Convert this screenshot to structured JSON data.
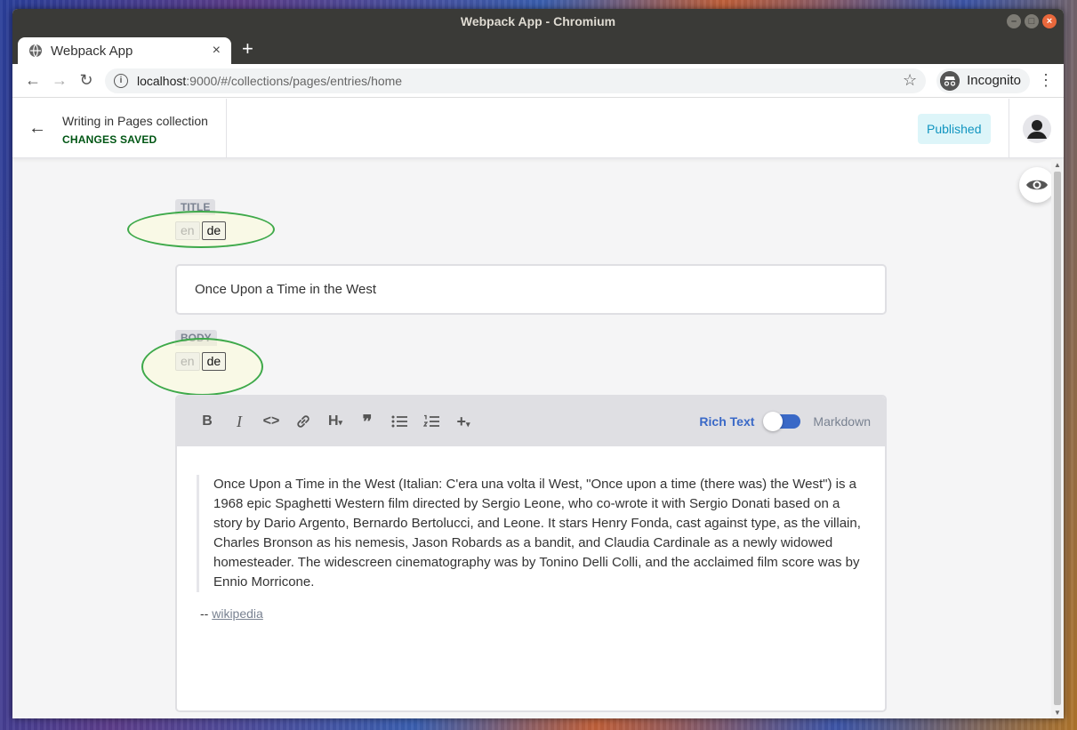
{
  "window": {
    "title": "Webpack App - Chromium",
    "controls": {
      "minimize": "–",
      "maximize": "□",
      "close": "×"
    }
  },
  "browser": {
    "tab_title": "Webpack App",
    "tab_close": "×",
    "new_tab": "+",
    "url_host": "localhost",
    "url_path": ":9000/#/collections/pages/entries/home",
    "incognito_label": "Incognito",
    "back": "←",
    "forward": "→",
    "reload": "↻",
    "star": "☆",
    "menu": "⋮",
    "info": "i"
  },
  "header": {
    "back": "←",
    "collection_text": "Writing in Pages collection",
    "status": "CHANGES SAVED",
    "publish_status": "Published"
  },
  "fields": {
    "title_label": "TITLE",
    "title_value": "Once Upon a Time in the West",
    "body_label": "BODY",
    "locales": [
      "en",
      "de"
    ]
  },
  "editor": {
    "toolbar": {
      "bold": "B",
      "italic": "I",
      "code": "<>",
      "heading": "H",
      "quote": "❞",
      "plus": "+"
    },
    "mode_rich": "Rich Text",
    "mode_markdown": "Markdown",
    "quote_text": "Once Upon a Time in the West (Italian: C'era una volta il West, \"Once upon a time (there was) the West\") is a 1968 epic Spaghetti Western film directed by Sergio Leone, who co-wrote it with Sergio Donati based on a story by Dario Argento, Bernardo Bertolucci, and Leone. It stars Henry Fonda, cast against type, as the villain, Charles Bronson as his nemesis, Jason Robards as a bandit, and Claudia Cardinale as a newly widowed homesteader. The widescreen cinematography was by Tonino Delli Colli, and the acclaimed film score was by Ennio Morricone.",
    "attribution_prefix": "-- ",
    "attribution_link": "wikipedia"
  },
  "colors": {
    "accent_blue": "#3a69c7",
    "saved_green": "#005614",
    "published_bg": "#ddf5f9",
    "published_text": "#1195c0",
    "annotation_ellipse": "#3ea94a"
  }
}
